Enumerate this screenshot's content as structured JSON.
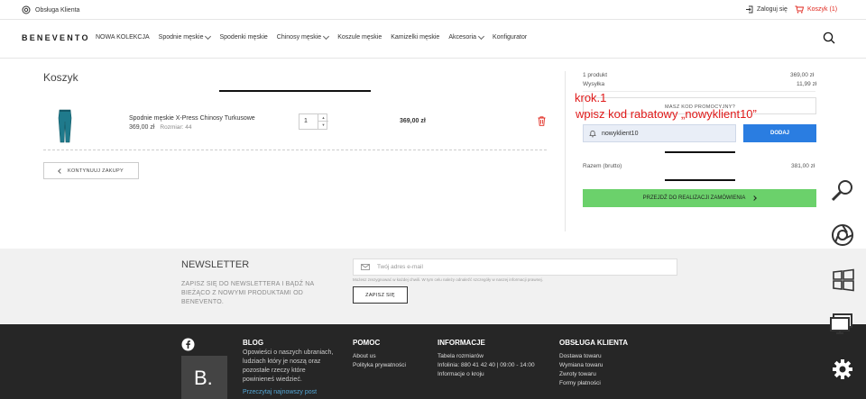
{
  "topbar": {
    "help_label": "Obsługa Klienta",
    "login_label": "Zaloguj się",
    "cart_label": "Koszyk (1)"
  },
  "nav": {
    "logo": "BENEVENTO",
    "items": [
      {
        "label": "NOWA KOLEKCJA",
        "dropdown": false
      },
      {
        "label": "Spodnie męskie",
        "dropdown": true
      },
      {
        "label": "Spodenki męskie",
        "dropdown": false
      },
      {
        "label": "Chinosy męskie",
        "dropdown": true
      },
      {
        "label": "Koszule męskie",
        "dropdown": false
      },
      {
        "label": "Kamizelki męskie",
        "dropdown": false
      },
      {
        "label": "Akcesoria",
        "dropdown": true
      },
      {
        "label": "Konfigurator",
        "dropdown": false
      }
    ]
  },
  "cart": {
    "title": "Koszyk",
    "item": {
      "name": "Spodnie męskie X-Press Chinosy Turkusowe",
      "price": "369,00 zł",
      "size_label": "Rozmiar: 44",
      "quantity": "1",
      "total": "369,00 zł"
    },
    "continue_label": "KONTYNUUJ ZAKUPY"
  },
  "summary": {
    "products_label": "1 produkt",
    "products_value": "369,00 zł",
    "shipping_label": "Wysyłka",
    "shipping_value": "11,99 zł",
    "promo_label": "MASZ KOD PROMOCYJNY?",
    "promo_code": "nowyklient10",
    "apply_label": "DODAJ",
    "total_label": "Razem (brutto)",
    "total_value": "381,00 zł",
    "checkout_label": "PRZEJDŹ DO REALIZACJI ZAMÓWIENIA"
  },
  "annotation": {
    "line1": "krok.1",
    "line2": "wpisz kod rabatowy „nowyklient10”"
  },
  "newsletter": {
    "title": "NEWSLETTER",
    "text": "ZAPISZ SIĘ DO NEWSLETTERA I BĄDŹ NA BIEŻĄCO Z NOWYMI PRODUKTAMI OD BENEVENTO.",
    "placeholder": "Twój adres e-mail",
    "disclaimer": "Możesz zrezygnować w każdej chwili. W tym celu należy odnaleźć szczegóły w naszej informacji prawnej.",
    "button": "ZAPISZ SIĘ"
  },
  "footer": {
    "blog": {
      "title": "BLOG",
      "text": "Opowieści o naszych ubraniach, ludziach który je noszą oraz pozostałe rzeczy które powinieneś wiedzieć.",
      "link": "Przeczytaj najnowszy post",
      "logo_letter": "B."
    },
    "help": {
      "title": "POMOC",
      "items": [
        "About us",
        "Polityka prywatności"
      ]
    },
    "info": {
      "title": "INFORMACJE",
      "items": [
        "Tabela rozmiarów",
        "Infolinia: 880 41 42 40 | 09:00 - 14:00",
        "Informacje o kroju"
      ]
    },
    "service": {
      "title": "OBSŁUGA KLIENTA",
      "items": [
        "Dostawa towaru",
        "Wymiana towaru",
        "Zwroty towaru",
        "Formy płatności"
      ]
    }
  },
  "side_icons": [
    "magnifier-icon",
    "browser-globe-icon",
    "windows-logo-icon",
    "monitor-icon",
    "gear-icon"
  ]
}
